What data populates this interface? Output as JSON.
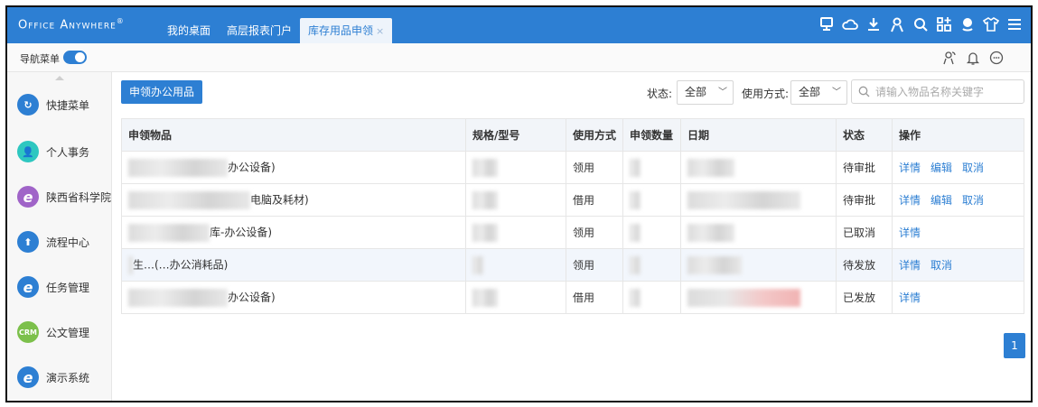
{
  "header": {
    "brand": "Office Anywhere",
    "brand_mark": "®",
    "tabs": [
      {
        "label": "我的桌面",
        "active": false
      },
      {
        "label": "高层报表门户",
        "active": false
      },
      {
        "label": "库存用品申领",
        "active": true,
        "close": "×"
      }
    ],
    "icons": [
      "desktop-icon",
      "cloud-icon",
      "download-icon",
      "user-icon",
      "search-icon",
      "apps-icon",
      "chat-icon",
      "shirt-icon",
      "menu-icon"
    ]
  },
  "subbar": {
    "nav_menu_label": "导航菜单",
    "nav_menu_on": true,
    "icons": [
      "users-icon",
      "bell-icon",
      "message-icon"
    ]
  },
  "sidebar": {
    "items": [
      {
        "label": "快捷菜单",
        "icon": "shortcut-icon",
        "color": "#2d7fd3",
        "glyph": "↻"
      },
      {
        "label": "个人事务",
        "icon": "person-icon",
        "color": "#2ec7c0",
        "glyph": "👤"
      },
      {
        "label": "陕西省科学院",
        "icon": "ie-icon",
        "color": "#a064c8",
        "glyph": "e"
      },
      {
        "label": "流程中心",
        "icon": "flow-icon",
        "color": "#2d7fd3",
        "glyph": "⬆"
      },
      {
        "label": "任务管理",
        "icon": "task-ie-icon",
        "color": "#2d7fd3",
        "glyph": "e"
      },
      {
        "label": "公文管理",
        "icon": "crm-icon",
        "color": "#7cc04b",
        "glyph": "CRM"
      },
      {
        "label": "演示系统",
        "icon": "demo-ie-icon",
        "color": "#2d7fd3",
        "glyph": "e"
      }
    ]
  },
  "toolbar": {
    "apply_button": "申领办公用品",
    "status_label": "状态:",
    "status_value": "全部",
    "usage_label": "使用方式:",
    "usage_value": "全部",
    "search_placeholder": "请输入物品名称关键字"
  },
  "table": {
    "columns": [
      "申领物品",
      "规格/型号",
      "使用方式",
      "申领数量",
      "日期",
      "状态",
      "操作"
    ],
    "rows": [
      {
        "item_suffix": "办公设备)",
        "usage": "领用",
        "status": "待审批",
        "actions": [
          "详情",
          "编辑",
          "取消"
        ]
      },
      {
        "item_suffix": "电脑及耗材)",
        "usage": "借用",
        "status": "待审批",
        "actions": [
          "详情",
          "编辑",
          "取消"
        ]
      },
      {
        "item_suffix": "库-办公设备)",
        "usage": "领用",
        "status": "已取消",
        "actions": [
          "详情"
        ]
      },
      {
        "item_suffix": "生…(…办公消耗品)",
        "usage": "领用",
        "status": "待发放",
        "actions": [
          "详情",
          "取消"
        ]
      },
      {
        "item_suffix": "办公设备)",
        "usage": "借用",
        "status": "已发放",
        "actions": [
          "详情"
        ]
      }
    ]
  },
  "pagination": {
    "current": "1"
  }
}
